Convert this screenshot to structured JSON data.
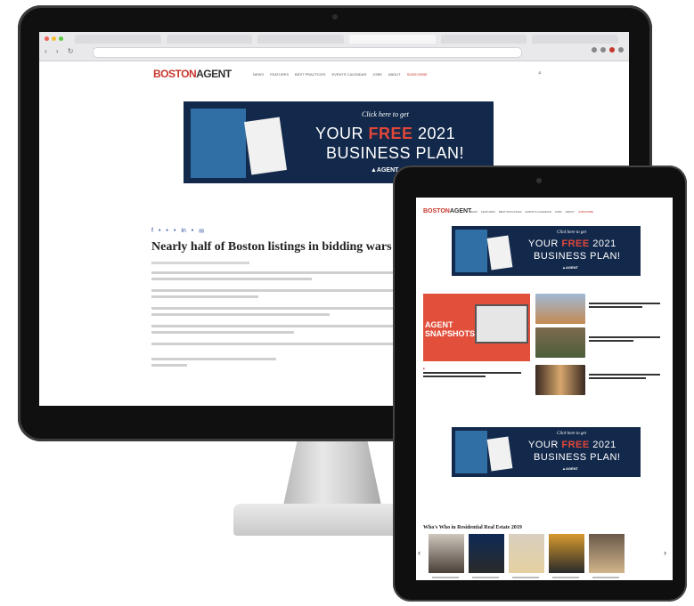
{
  "monitor_page": {
    "logo_part1": "BOSTON",
    "logo_part2": "AGENT",
    "menu": [
      "NEWS",
      "FEATURES",
      "BEST PRACTICES",
      "EVENTS CALENDAR",
      "JOBS",
      "ABOUT",
      "SUBSCRIBE"
    ],
    "ad": {
      "cta": "Click here to get",
      "line1_pre": "YOUR ",
      "line1_free": "FREE",
      "line1_post": " 2021",
      "line2": "BUSINESS PLAN!",
      "brand": "▲AGENT"
    },
    "share_icons": [
      "f",
      "•",
      "•",
      "•",
      "in",
      "•",
      "✉"
    ],
    "headline": "Nearly half of Boston listings in bidding wars"
  },
  "tablet_page": {
    "logo_part1": "BOSTON",
    "logo_part2": "AGENT",
    "menu": [
      "NEWS",
      "FEATURES",
      "BEST PRACTICES",
      "EVENTS CALENDAR",
      "JOBS",
      "ABOUT",
      "SUBSCRIBE"
    ],
    "ad": {
      "cta": "Click here to get",
      "line1_pre": "YOUR ",
      "line1_free": "FREE",
      "line1_post": " 2021",
      "line2": "BUSINESS PLAN!",
      "brand": "▲AGENT"
    },
    "snapshots_label_1": "AGENT",
    "snapshots_label_2": "SNAPSHOTS",
    "whos_who_title": "Who's Who in Residential Real Estate 2019",
    "prev_arrow": "‹",
    "next_arrow": "›"
  },
  "colors": {
    "brand_red": "#c8372d",
    "ad_navy": "#13294b",
    "snapshot_orange": "#e2503c"
  }
}
